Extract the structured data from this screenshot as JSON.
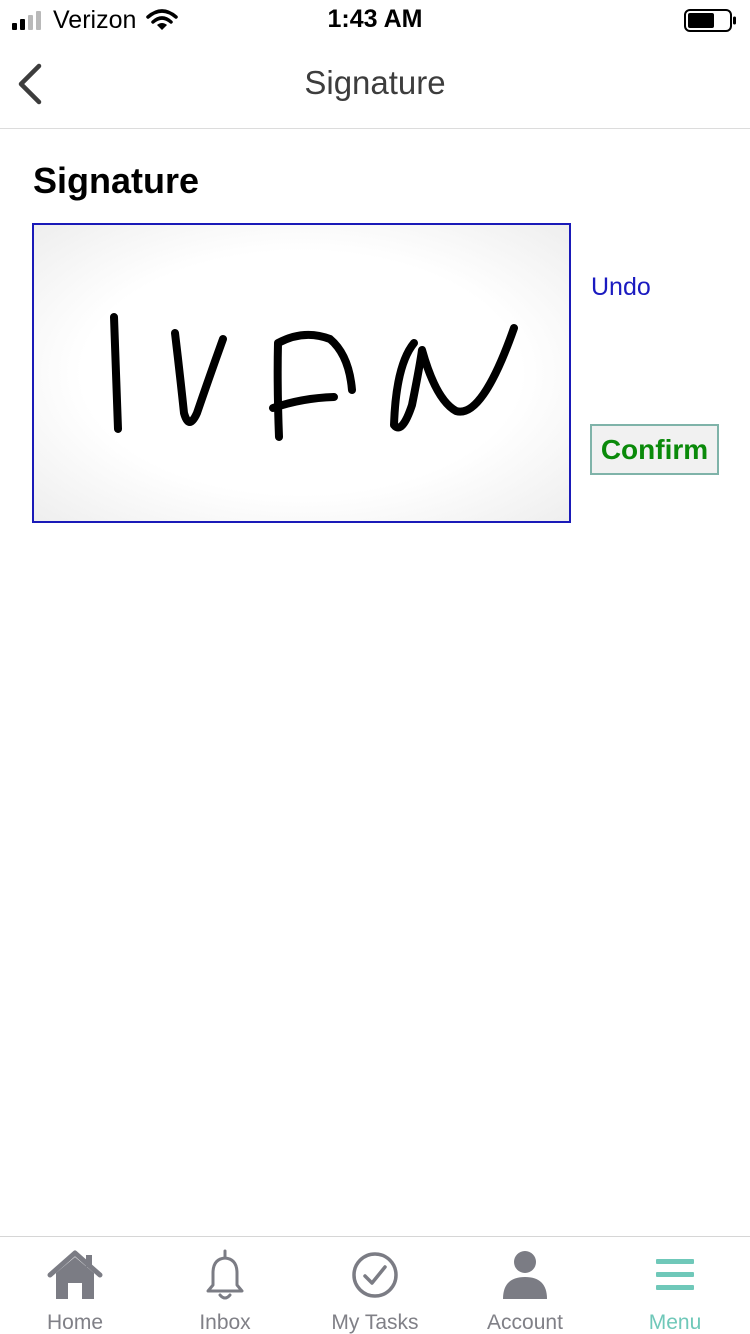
{
  "status_bar": {
    "carrier": "Verizon",
    "time": "1:43 AM",
    "icons": [
      "signal-icon",
      "wifi-icon",
      "battery-icon"
    ]
  },
  "nav": {
    "title": "Signature",
    "back_icon": "chevron-left-icon"
  },
  "content": {
    "section_title": "Signature",
    "undo_label": "Undo",
    "confirm_label": "Confirm"
  },
  "tabs": [
    {
      "label": "Home",
      "icon": "home-icon",
      "active": false
    },
    {
      "label": "Inbox",
      "icon": "bell-icon",
      "active": false
    },
    {
      "label": "My Tasks",
      "icon": "check-circle-icon",
      "active": false
    },
    {
      "label": "Account",
      "icon": "person-icon",
      "active": false
    },
    {
      "label": "Menu",
      "icon": "menu-icon",
      "active": true
    }
  ],
  "colors": {
    "pad_border": "#1a1ab8",
    "undo_text": "#1a1ac0",
    "confirm_text": "#0a8a0a",
    "confirm_border": "#7fb3a9",
    "tab_inactive": "#808087",
    "tab_active": "#6fc8b9"
  }
}
